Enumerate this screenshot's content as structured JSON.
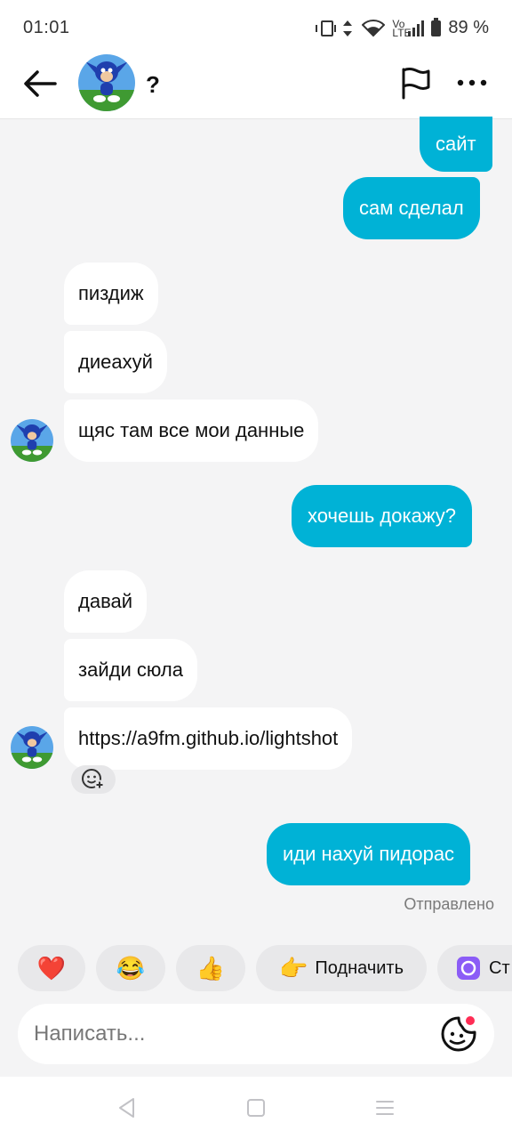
{
  "status_bar": {
    "time": "01:01",
    "battery": "89 %",
    "data_label": "Vo LTE"
  },
  "header": {
    "contact_name": "?"
  },
  "messages": [
    {
      "dir": "out",
      "text": "сайт"
    },
    {
      "dir": "out",
      "text": "сам сделал"
    },
    {
      "dir": "in",
      "text": "пиздиж"
    },
    {
      "dir": "in",
      "text": "диеахуй"
    },
    {
      "dir": "in",
      "text": "щяс там все мои данные"
    },
    {
      "dir": "out",
      "text": "хочешь докажу?"
    },
    {
      "dir": "in",
      "text": "давай"
    },
    {
      "dir": "in",
      "text": "зайди сюла"
    },
    {
      "dir": "in",
      "text": "https://a9fm.github.io/lightshot"
    },
    {
      "dir": "out",
      "text": "иди нахуй пидорас"
    }
  ],
  "sent_status": "Отправлено",
  "quick_replies": [
    {
      "icon": "heart-emoji",
      "emoji": "❤️",
      "label": ""
    },
    {
      "icon": "laughing-emoji",
      "emoji": "😂",
      "label": ""
    },
    {
      "icon": "thumbs-up-emoji",
      "emoji": "👍",
      "label": ""
    },
    {
      "icon": "pointing-hand-emoji",
      "emoji": "👉",
      "label": "Подначить"
    },
    {
      "icon": "sticker-app-icon",
      "emoji": "",
      "label": "Ст"
    }
  ],
  "composer": {
    "placeholder": "Написать..."
  },
  "colors": {
    "outgoing_bubble": "#00b2d6",
    "incoming_bubble": "#ffffff",
    "background": "#f4f4f5"
  }
}
